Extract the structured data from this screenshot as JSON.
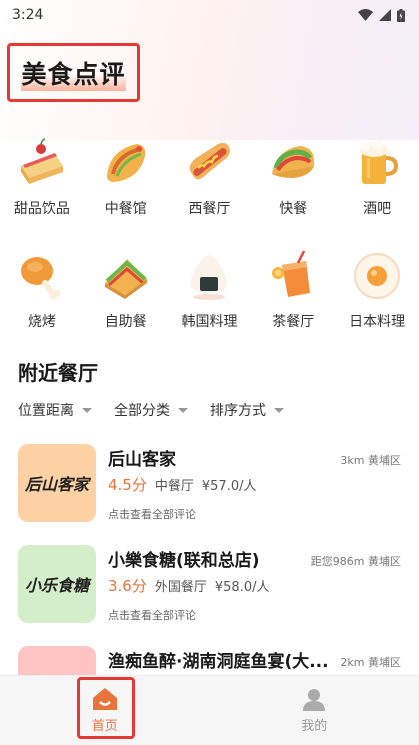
{
  "status_bar": {
    "time": "3:24"
  },
  "app": {
    "title": "美食点评"
  },
  "categories": [
    {
      "label": "甜品饮品",
      "icon": "cake-icon"
    },
    {
      "label": "中餐馆",
      "icon": "taco-roll-icon"
    },
    {
      "label": "西餐厅",
      "icon": "hotdog-icon"
    },
    {
      "label": "快餐",
      "icon": "taco-icon"
    },
    {
      "label": "酒吧",
      "icon": "beer-mug-icon"
    },
    {
      "label": "烧烤",
      "icon": "chicken-leg-icon"
    },
    {
      "label": "自助餐",
      "icon": "sandwich-icon"
    },
    {
      "label": "韩国料理",
      "icon": "onigiri-icon"
    },
    {
      "label": "茶餐厅",
      "icon": "drink-cup-icon"
    },
    {
      "label": "日本料理",
      "icon": "fried-egg-icon"
    }
  ],
  "nearby": {
    "title": "附近餐厅",
    "filters": [
      "位置距离",
      "全部分类",
      "排序方式"
    ]
  },
  "restaurants": [
    {
      "name": "后山客家",
      "thumb_text": "后山客家",
      "thumb_color": "#ffd2a6",
      "distance": "3km 黄埔区",
      "score": "4.5分",
      "category": "中餐厅",
      "price": "¥57.0/人",
      "link": "点击查看全部评论"
    },
    {
      "name": "小樂食糖(联和总店)",
      "thumb_text": "小乐食糖",
      "thumb_color": "#d3efc9",
      "distance": "距您986m 黄埔区",
      "score": "3.6分",
      "category": "外国餐厅",
      "price": "¥58.0/人",
      "link": "点击查看全部评论"
    },
    {
      "name": "渔痴鱼醉·湖南洞庭鱼宴(大...",
      "thumb_text": "",
      "thumb_color": "#ffc4c4",
      "distance": "2km 黄埔区",
      "score": "",
      "category": "",
      "price": "",
      "link": ""
    }
  ],
  "tabbar": {
    "home_label": "首页",
    "mine_label": "我的",
    "active_color": "#e8743b",
    "inactive_color": "#999999"
  }
}
